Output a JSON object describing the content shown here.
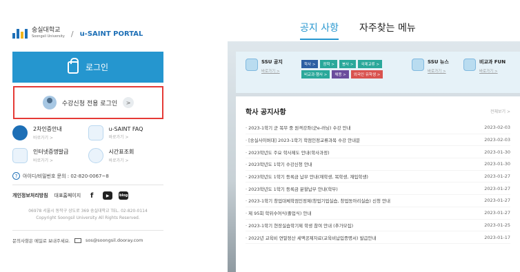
{
  "left": {
    "logo": {
      "name": "숭실대학교",
      "sub": "Soongsil University",
      "separator": "/",
      "portal": "u-SAINT PORTAL"
    },
    "login_label": "로그인",
    "course_login_label": "수강신청 전용 로그인",
    "course_login_arrow": ">",
    "quick_links": [
      {
        "title": "2차인증안내",
        "link": "바로가기 >",
        "icon": "shield-icon"
      },
      {
        "title": "u-SAINT FAQ",
        "link": "바로가기 >",
        "icon": "faq-icon"
      },
      {
        "title": "인터넷증명발급",
        "link": "바로가기 >",
        "icon": "certificate-icon"
      },
      {
        "title": "시간표조회",
        "link": "바로가기 >",
        "icon": "clock-icon"
      }
    ],
    "help": {
      "icon": "?",
      "text": "아이디/비밀번호 문의 : 02-820-0067~8"
    },
    "links": {
      "privacy": "개인정보처리방침",
      "homepage": "대표홈페이지",
      "facebook": "f",
      "youtube": "▶",
      "blog": "blog"
    },
    "address": [
      "06978 서울시 동작구 상도로 369 숭실대학교 TEL. 02-820-0114",
      "Copyright Soongsil University All Rights Reserved."
    ],
    "contact": {
      "text": "문의사항은 메일로 보내주세요.",
      "email": "sos@soongsil.dooray.com"
    }
  },
  "right": {
    "tabs": [
      {
        "label": "공지 사항",
        "active": true
      },
      {
        "label": "자주찾는 메뉴",
        "active": false
      }
    ],
    "notice_bar": {
      "ssu_notice": {
        "title": "SSU 공지",
        "go": "바로가기 >"
      },
      "chips": [
        {
          "label": "학사 >",
          "color": "blue"
        },
        {
          "label": "장학 >",
          "color": "teal"
        },
        {
          "label": "봉사 >",
          "color": "teal"
        },
        {
          "label": "국제교류 >",
          "color": "teal"
        },
        {
          "label": "비교과·행사 >",
          "color": "teal"
        },
        {
          "label": "채용 >",
          "color": "purple"
        },
        {
          "label": "외국인 유학생 >",
          "color": "red"
        }
      ],
      "ssu_news": {
        "title": "SSU 뉴스",
        "go": "바로가기 >"
      },
      "fun": {
        "title": "비교과 FUN",
        "go": "바로가기 >"
      }
    },
    "board": {
      "title": "학사 공지사항",
      "see_all": "전체보기 >",
      "rows": [
        {
          "title": "· 2023-1학기 군 복무 중 원격강좌(군e-러닝) 수강 안내",
          "date": "2023-02-03"
        },
        {
          "title": "· [숭실사이버대] 2023-1학기 학점인정교류과목 수강 안내문",
          "date": "2023-02-03"
        },
        {
          "title": "· 2023학년도 주요 학사제도 안내(학사과정)",
          "date": "2023-01-30"
        },
        {
          "title": "· 2023학년도 1학기 수강신청 안내",
          "date": "2023-01-30"
        },
        {
          "title": "· 2023학년도 1학기 등록금 납부 안내(재학생, 복학생, 재입학생)",
          "date": "2023-01-27"
        },
        {
          "title": "· 2023학년도 1학기 등록금 분할납부 안내(학부)",
          "date": "2023-01-27"
        },
        {
          "title": "· 2023-1학기 창업대체학점인정제(창업기업실습, 창업동아리실습) 신청 안내",
          "date": "2023-01-27"
        },
        {
          "title": "· 제 95회 학위수여식(졸업식) 안내",
          "date": "2023-01-27"
        },
        {
          "title": "· 2023-1학기 현장실습학기제 학생 참여 안내 (추가모집)",
          "date": "2023-01-25"
        },
        {
          "title": "· 2022년 교육비 연말정산 세액공제자료(교육비납입증명서) 발급안내",
          "date": "2023-01-17"
        }
      ]
    }
  }
}
